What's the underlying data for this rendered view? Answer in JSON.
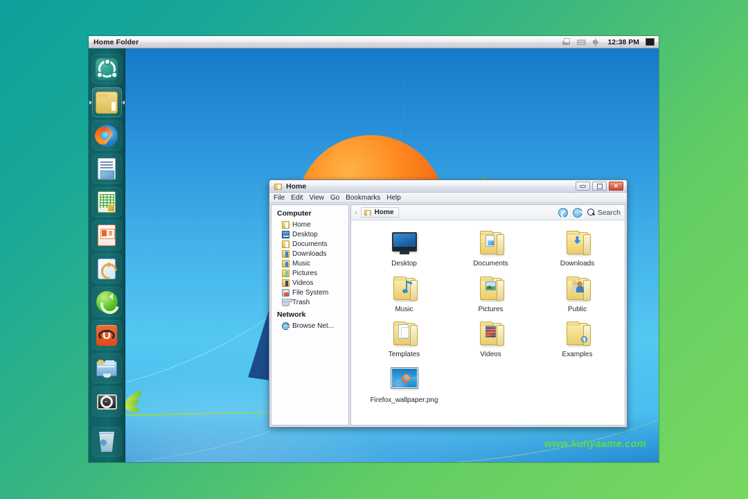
{
  "panel": {
    "title": "Home Folder",
    "clock": "12:38 PM",
    "tray": [
      {
        "name": "printer-icon",
        "label": "Printer"
      },
      {
        "name": "keyboard-indicator-icon",
        "label": "Keyboard layout"
      },
      {
        "name": "volume-icon",
        "label": "Volume"
      }
    ]
  },
  "dock": {
    "items": [
      {
        "label": "Ubuntu Dash",
        "icon": "ubuntu-logo-icon",
        "active": false
      },
      {
        "label": "Home Folder",
        "icon": "folder-icon",
        "active": true
      },
      {
        "label": "Firefox Web Browser",
        "icon": "firefox-icon",
        "active": false
      },
      {
        "label": "LibreOffice Writer",
        "icon": "writer-document-icon",
        "active": false
      },
      {
        "label": "LibreOffice Calc",
        "icon": "calc-spreadsheet-icon",
        "active": false
      },
      {
        "label": "LibreOffice Impress",
        "icon": "impress-presentation-icon",
        "active": false
      },
      {
        "label": "Ubuntu Help",
        "icon": "help-update-icon",
        "active": false
      },
      {
        "label": "Software Updater",
        "icon": "sync-refresh-icon",
        "active": false
      },
      {
        "label": "Ubuntu Software Center",
        "icon": "ubuntu-software-icon",
        "active": false
      },
      {
        "label": "Displays",
        "icon": "display-monitor-icon",
        "active": false
      },
      {
        "label": "System Settings",
        "icon": "system-settings-icon",
        "active": false
      },
      {
        "label": "Trash",
        "icon": "trash-icon",
        "active": false
      }
    ]
  },
  "desktop": {
    "watermark": "www.kuhyaame.com",
    "watermark_color": "#62d84a"
  },
  "file_manager": {
    "title": "Home",
    "menu": [
      "File",
      "Edit",
      "View",
      "Go",
      "Bookmarks",
      "Help"
    ],
    "window_buttons": [
      {
        "name": "minimize-button",
        "label": "—"
      },
      {
        "name": "maximize-button",
        "label": "□"
      },
      {
        "name": "close-button",
        "label": "✕"
      }
    ],
    "breadcrumb": {
      "prefix": "‹",
      "current": "Home"
    },
    "toolbar": {
      "back_label": "Back",
      "forward_label": "Forward",
      "search_label": "Search"
    },
    "sidebar": {
      "sections": [
        {
          "heading": "Computer",
          "items": [
            {
              "label": "Home",
              "icon": "home-folder-icon"
            },
            {
              "label": "Desktop",
              "icon": "desktop-icon"
            },
            {
              "label": "Documents",
              "icon": "documents-folder-icon"
            },
            {
              "label": "Downloads",
              "icon": "downloads-folder-icon"
            },
            {
              "label": "Music",
              "icon": "music-folder-icon"
            },
            {
              "label": "Pictures",
              "icon": "pictures-folder-icon"
            },
            {
              "label": "Videos",
              "icon": "videos-folder-icon"
            },
            {
              "label": "File System",
              "icon": "file-system-icon"
            },
            {
              "label": "Trash",
              "icon": "trash-icon"
            }
          ]
        },
        {
          "heading": "Network",
          "items": [
            {
              "label": "Browse Net...",
              "icon": "network-icon"
            }
          ]
        }
      ]
    },
    "files": [
      {
        "label": "Desktop",
        "icon": "desktop-monitor-icon",
        "kind": "desktop"
      },
      {
        "label": "Documents",
        "icon": "documents-folder-icon",
        "kind": "folder-documents"
      },
      {
        "label": "Downloads",
        "icon": "downloads-folder-icon",
        "kind": "folder-downloads"
      },
      {
        "label": "Music",
        "icon": "music-folder-icon",
        "kind": "folder-music"
      },
      {
        "label": "Pictures",
        "icon": "pictures-folder-icon",
        "kind": "folder-pictures"
      },
      {
        "label": "Public",
        "icon": "public-folder-icon",
        "kind": "folder-public"
      },
      {
        "label": "Templates",
        "icon": "templates-folder-icon",
        "kind": "folder-templates"
      },
      {
        "label": "Videos",
        "icon": "videos-folder-icon",
        "kind": "folder-videos"
      },
      {
        "label": "Examples",
        "icon": "examples-folder-link-icon",
        "kind": "folder-examples"
      },
      {
        "label": "Firefox_wallpaper.png",
        "icon": "image-thumbnail-icon",
        "kind": "image"
      }
    ]
  }
}
